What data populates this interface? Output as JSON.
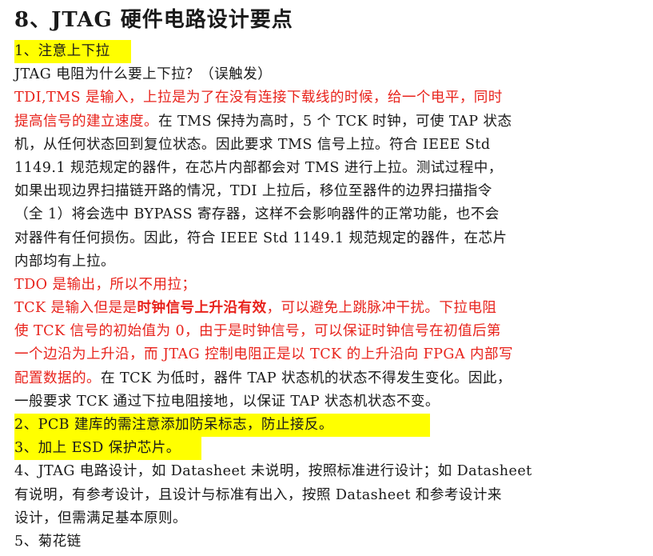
{
  "title": "8、JTAG 硬件电路设计要点",
  "sections": {
    "s1": "1、注意上下拉",
    "s2": "2、PCB 建库的需注意添加防呆标志，防止接反。",
    "s3": "3、加上 ESD 保护芯片。",
    "s5": "5、菊花链"
  },
  "p1": {
    "q": "JTAG 电阻为什么要上下拉？（误触发）",
    "l1_red": "TDI,TMS 是输入，上拉是为了在没有连接下载线的时候，给一个电平，同时",
    "l2_red": "提高信号的建立速度。",
    "l2_black": "在 TMS 保持为高时，5 个 TCK 时钟，可使 TAP 状态",
    "l3": "机，从任何状态回到复位状态。因此要求 TMS 信号上拉。符合 IEEE Std",
    "l4": "1149.1 规范规定的器件，在芯片内部都会对 TMS 进行上拉。测试过程中，",
    "l5": "如果出现边界扫描链开路的情况，TDI 上拉后，移位至器件的边界扫描指令",
    "l6": "（全 1）将会选中 BYPASS 寄存器，这样不会影响器件的正常功能，也不会",
    "l7": "对器件有任何损伤。因此，符合 IEEE Std 1149.1 规范规定的器件，在芯片",
    "l8": "内部均有上拉。"
  },
  "p2": {
    "tdo": "TDO 是输出，所以不用拉；",
    "l1_a": "TCK 是输入但是是",
    "l1_bold": "时钟信号上升沿有效",
    "l1_b": "，可以避免上跳脉冲干扰。下拉电阻",
    "l2": "使 TCK 信号的初始值为 0，由于是时钟信号，可以保证时钟信号在初值后第",
    "l3": "一个边沿为上升沿，而 JTAG 控制电阻正是以 TCK 的上升沿向 FPGA 内部写",
    "l4_red": "配置数据的。",
    "l4_black": "在 TCK 为低时，器件 TAP 状态机的状态不得发生变化。因此，",
    "l5": "一般要求 TCK 通过下拉电阻接地，以保证 TAP 状态机状态不变。"
  },
  "p4": {
    "l1": "4、JTAG 电路设计，如 Datasheet 未说明，按照标准进行设计；如 Datasheet",
    "l2": "有说明，有参考设计，且设计与标准有出入，按照 Datasheet 和参考设计来",
    "l3": "设计，但需满足基本原则。"
  },
  "colors": {
    "highlight": "#ffff00",
    "red": "#e8231c",
    "text": "#1a1a1a"
  }
}
